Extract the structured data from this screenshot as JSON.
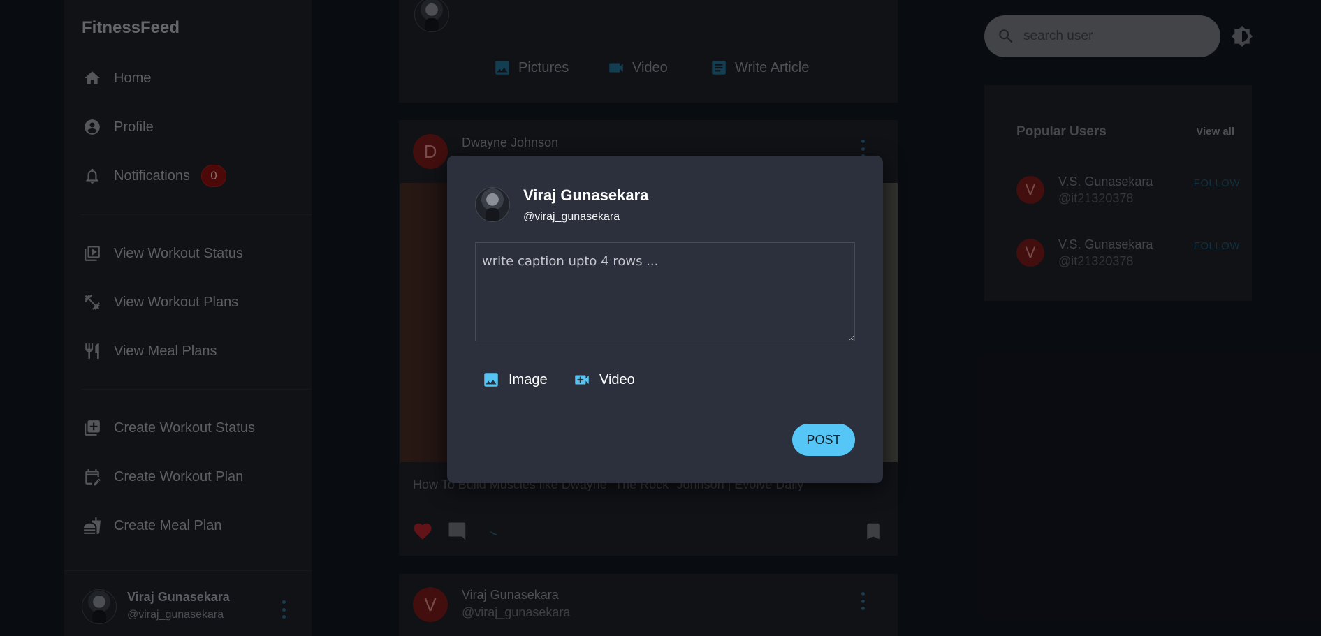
{
  "app": {
    "brand": "FitnessFeed"
  },
  "sidebar": {
    "items": [
      {
        "label": "Home",
        "icon": "home-icon"
      },
      {
        "label": "Profile",
        "icon": "account-circle-icon"
      },
      {
        "label": "Notifications",
        "icon": "bell-icon",
        "badge": "0"
      },
      {
        "label": "View Workout Status",
        "icon": "video-library-icon"
      },
      {
        "label": "View Workout Plans",
        "icon": "dumbbell-icon"
      },
      {
        "label": "View Meal Plans",
        "icon": "restaurant-icon"
      },
      {
        "label": "Create Workout Status",
        "icon": "library-add-icon"
      },
      {
        "label": "Create Workout Plan",
        "icon": "edit-calendar-icon"
      },
      {
        "label": "Create Meal Plan",
        "icon": "fastfood-icon"
      }
    ],
    "profile": {
      "name": "Viraj Gunasekara",
      "handle": "@viraj_gunasekara"
    }
  },
  "composer": {
    "actions": [
      {
        "label": "Pictures",
        "icon": "image-icon"
      },
      {
        "label": "Video",
        "icon": "videocam-icon"
      },
      {
        "label": "Write Article",
        "icon": "article-icon"
      }
    ]
  },
  "feed": {
    "posts": [
      {
        "avatar_letter": "D",
        "author": "Dwayne Johnson",
        "caption": "How To Build Muscles like Dwayne \"The Rock\" Johnson | Evolve Daily"
      },
      {
        "avatar_letter": "V",
        "author": "Viraj Gunasekara",
        "handle": "@viraj_gunasekara"
      }
    ]
  },
  "search": {
    "placeholder": "search user"
  },
  "popular": {
    "title": "Popular Users",
    "view_all": "View all",
    "users": [
      {
        "letter": "V",
        "name": "V.S. Gunasekara",
        "handle": "@it21320378",
        "action": "FOLLOW"
      },
      {
        "letter": "V",
        "name": "V.S. Gunasekara",
        "handle": "@it21320378",
        "action": "FOLLOW"
      }
    ]
  },
  "modal": {
    "name": "Viraj Gunasekara",
    "handle": "@viraj_gunasekara",
    "caption_placeholder": "write caption upto 4 rows ...",
    "attach_image": "Image",
    "attach_video": "Video",
    "post_button": "POST"
  },
  "colors": {
    "accent": "#55c6f6",
    "badge": "#8c1010",
    "avatar_red": "#7b1a1a"
  }
}
